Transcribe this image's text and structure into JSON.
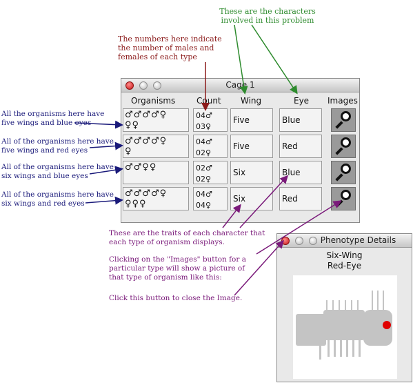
{
  "annotations": {
    "characters_note": "These are the characters\ninvolved in this problem",
    "numbers_note": "The numbers here indicate\nthe number of males and\nfemales of each type",
    "row1_note": "All the organisms  here have\nfive wings and blue eyes",
    "row2_note": "All of the organisms here have\nfive wings and red eyes",
    "row3_note": "All of the organisms here have\nsix wings and blue eyes",
    "row4_note": "All of the organisms here have\nsix wings and red eyes",
    "traits_note": "These are the traits of each character that\neach type of organism displays.",
    "images_note": "Clicking on the \"Images\" button for a\nparticular type will show a picture of\nthat type of organism like this:",
    "close_note": "Click this button to close the Image.",
    "colors": {
      "green": "#2e8b2e",
      "red": "#8b1a1a",
      "navy": "#1a1a7a",
      "purple": "#7a1a7a"
    }
  },
  "cage": {
    "title": "Cage 1",
    "headers": {
      "organisms": "Organisms",
      "count": "Count",
      "wing": "Wing",
      "eye": "Eye",
      "images": "Images"
    },
    "rows": [
      {
        "organisms_line1": "♂♂♂♂♀",
        "organisms_line2": "♀♀",
        "males": "04♂",
        "females": "03♀",
        "wing": "Five",
        "eye": "Blue",
        "image_icon": "magnifier-icon"
      },
      {
        "organisms_line1": "♂♂♂♂♀",
        "organisms_line2": "♀",
        "males": "04♂",
        "females": "02♀",
        "wing": "Five",
        "eye": "Red",
        "image_icon": "magnifier-icon"
      },
      {
        "organisms_line1": "♂♂♀♀",
        "organisms_line2": "",
        "males": "02♂",
        "females": "02♀",
        "wing": "Six",
        "eye": "Blue",
        "image_icon": "magnifier-icon"
      },
      {
        "organisms_line1": "♂♂♂♂♀",
        "organisms_line2": "♀♀♀",
        "males": "04♂",
        "females": "04♀",
        "wing": "Six",
        "eye": "Red",
        "image_icon": "magnifier-icon"
      }
    ]
  },
  "phenotype": {
    "title": "Phenotype Details",
    "wing_label": "Six-Wing",
    "eye_label": "Red-Eye",
    "body_color": "#c4c4c4",
    "eye_color": "#e00000"
  }
}
